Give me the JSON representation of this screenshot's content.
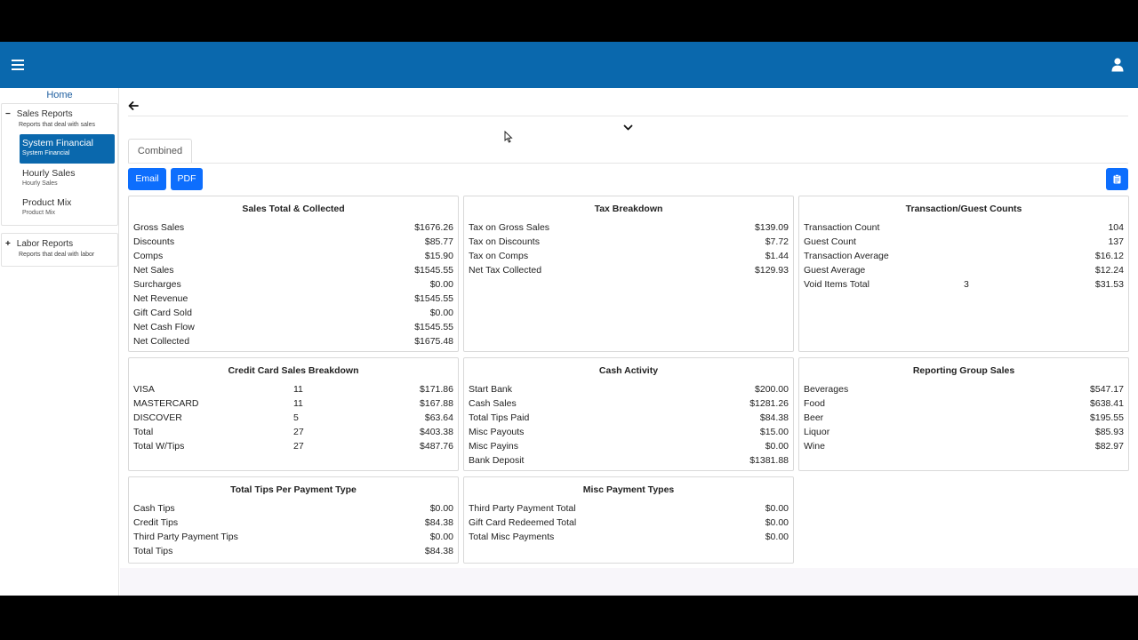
{
  "sidebar": {
    "home": "Home",
    "sales": {
      "title": "Sales Reports",
      "subtitle": "Reports that deal with sales",
      "items": [
        {
          "label": "System Financial",
          "sub": "System Financial"
        },
        {
          "label": "Hourly Sales",
          "sub": "Hourly Sales"
        },
        {
          "label": "Product Mix",
          "sub": "Product Mix"
        }
      ]
    },
    "labor": {
      "title": "Labor Reports",
      "subtitle": "Reports that deal with labor"
    }
  },
  "main": {
    "tab": "Combined",
    "email_label": "Email",
    "pdf_label": "PDF"
  },
  "cards": {
    "sales_total": {
      "title": "Sales Total & Collected",
      "rows": [
        {
          "l": "Gross Sales",
          "r": "$1676.26"
        },
        {
          "l": "Discounts",
          "r": "$85.77"
        },
        {
          "l": "Comps",
          "r": "$15.90"
        },
        {
          "l": "Net Sales",
          "r": "$1545.55"
        },
        {
          "l": "Surcharges",
          "r": "$0.00"
        },
        {
          "l": "Net Revenue",
          "r": "$1545.55"
        },
        {
          "l": "Gift Card Sold",
          "r": "$0.00"
        },
        {
          "l": "Net Cash Flow",
          "r": "$1545.55"
        },
        {
          "l": "Net Collected",
          "r": "$1675.48"
        }
      ]
    },
    "tax": {
      "title": "Tax Breakdown",
      "rows": [
        {
          "l": "Tax on Gross Sales",
          "r": "$139.09"
        },
        {
          "l": "Tax on Discounts",
          "r": "$7.72"
        },
        {
          "l": "Tax on Comps",
          "r": "$1.44"
        },
        {
          "l": "Net Tax Collected",
          "r": "$129.93"
        }
      ]
    },
    "transactions": {
      "title": "Transaction/Guest Counts",
      "rows": [
        {
          "l": "Transaction Count",
          "r": "104"
        },
        {
          "l": "Guest Count",
          "r": "137"
        },
        {
          "l": "Transaction Average",
          "r": "$16.12"
        },
        {
          "l": "Guest Average",
          "r": "$12.24"
        },
        {
          "l": "Void Items Total",
          "m": "3",
          "r": "$31.53"
        }
      ]
    },
    "credit": {
      "title": "Credit Card Sales Breakdown",
      "rows": [
        {
          "l": "VISA",
          "m": "11",
          "r": "$171.86"
        },
        {
          "l": "MASTERCARD",
          "m": "11",
          "r": "$167.88"
        },
        {
          "l": "DISCOVER",
          "m": "5",
          "r": "$63.64"
        },
        {
          "l": "Total",
          "m": "27",
          "r": "$403.38"
        },
        {
          "l": "Total W/Tips",
          "m": "27",
          "r": "$487.76"
        }
      ]
    },
    "cash": {
      "title": "Cash Activity",
      "rows": [
        {
          "l": "Start Bank",
          "r": "$200.00"
        },
        {
          "l": "Cash Sales",
          "r": "$1281.26"
        },
        {
          "l": "Total Tips Paid",
          "r": "$84.38"
        },
        {
          "l": "Misc Payouts",
          "r": "$15.00"
        },
        {
          "l": "Misc Payins",
          "r": "$0.00"
        },
        {
          "l": "Bank Deposit",
          "r": "$1381.88"
        }
      ]
    },
    "reporting": {
      "title": "Reporting Group Sales",
      "rows": [
        {
          "l": "Beverages",
          "r": "$547.17"
        },
        {
          "l": "Food",
          "r": "$638.41"
        },
        {
          "l": "Beer",
          "r": "$195.55"
        },
        {
          "l": "Liquor",
          "r": "$85.93"
        },
        {
          "l": "Wine",
          "r": "$82.97"
        }
      ]
    },
    "tips": {
      "title": "Total Tips Per Payment Type",
      "rows": [
        {
          "l": "Cash Tips",
          "r": "$0.00"
        },
        {
          "l": "Credit Tips",
          "r": "$84.38"
        },
        {
          "l": "Third Party Payment Tips",
          "r": "$0.00"
        },
        {
          "l": "Total Tips",
          "r": "$84.38"
        }
      ]
    },
    "misc": {
      "title": "Misc Payment Types",
      "rows": [
        {
          "l": "Third Party Payment Total",
          "r": "$0.00"
        },
        {
          "l": "Gift Card Redeemed Total",
          "r": "$0.00"
        },
        {
          "l": "Total Misc Payments",
          "r": "$0.00"
        }
      ]
    }
  },
  "icons": {
    "menu": "hamburger-icon",
    "user": "user-icon",
    "back": "arrow-left-icon",
    "expand": "chevron-down-icon",
    "clipboard": "clipboard-icon"
  },
  "colors": {
    "appbar": "#0a68ad",
    "button": "#0d6efd",
    "active_nav": "#0a68ad"
  }
}
